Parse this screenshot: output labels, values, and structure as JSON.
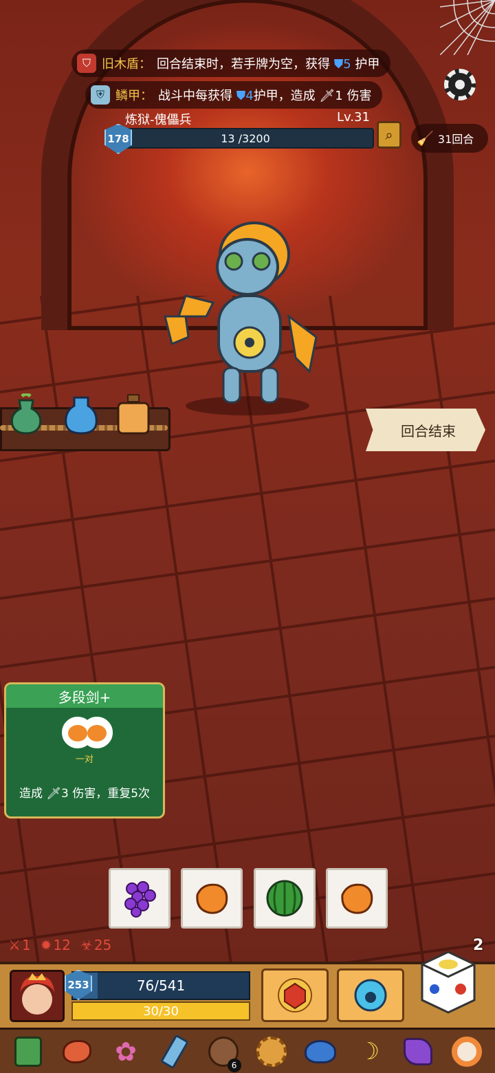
{
  "buffs": [
    {
      "name": "旧木盾",
      "sep": "：",
      "text_before": "回合结束时，若手牌为空，获得",
      "shield_value": "5",
      "text_after": "护甲",
      "icon": "wood-shield-icon"
    },
    {
      "name": "鳞甲",
      "sep": "：",
      "text_before": "战斗中每获得",
      "shield_value": "4",
      "text_mid": "护甲，造成",
      "damage_value": "1",
      "text_after": "伤害",
      "icon": "scale-armor-icon"
    }
  ],
  "enemy": {
    "name": "炼狱-傀儡兵",
    "level": "Lv.31",
    "armor": "178",
    "hp_text": "13 /3200",
    "hp_fraction": 0.004
  },
  "round": {
    "text": "31回合"
  },
  "end_turn": {
    "label": "回合结束"
  },
  "card": {
    "title": "多段剑+",
    "tag": "一对",
    "desc_before": "造成",
    "damage": "3",
    "desc_after": "伤害，重复5次"
  },
  "dice_slots": [
    "grape-icon",
    "orange-fruit-icon",
    "watermelon-icon",
    "orange-fruit-icon"
  ],
  "stats": {
    "attack": "1",
    "burst": "12",
    "curse": "25"
  },
  "dice_count": "2",
  "hero": {
    "armor": "253",
    "hp_text": "76/541",
    "hp_fraction": 0.14,
    "energy_text": "30/30",
    "energy_fraction": 1.0
  },
  "relics": [
    {
      "icon": "green-cloth-icon"
    },
    {
      "icon": "meat-leg-icon"
    },
    {
      "icon": "pink-flower-icon"
    },
    {
      "icon": "ice-bottle-icon"
    },
    {
      "icon": "button-icon",
      "badge": "6"
    },
    {
      "icon": "lion-head-icon"
    },
    {
      "icon": "blue-slime-icon"
    },
    {
      "icon": "banana-icon"
    },
    {
      "icon": "purple-scarf-icon"
    },
    {
      "icon": "donut-icon"
    }
  ],
  "colors": {
    "shield": "#4aa3ff",
    "buff_name": "#f2c54a",
    "card_green": "#1f6a38",
    "energy": "#f5c22a",
    "hp_bar": "#1f3a56"
  }
}
